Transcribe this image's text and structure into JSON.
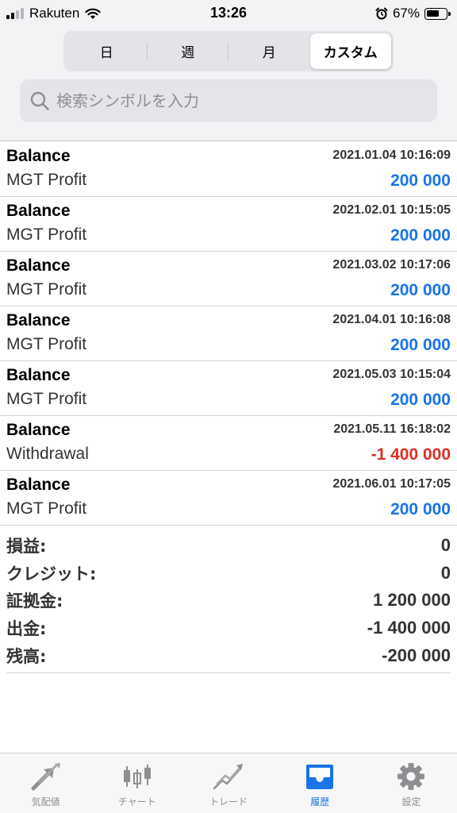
{
  "status_bar": {
    "carrier": "Rakuten",
    "time": "13:26",
    "battery_percent": "67%",
    "battery_level": 0.67
  },
  "period_tabs": [
    {
      "label": "日",
      "active": false
    },
    {
      "label": "週",
      "active": false
    },
    {
      "label": "月",
      "active": false
    },
    {
      "label": "カスタム",
      "active": true
    }
  ],
  "search": {
    "placeholder": "検索シンボルを入力",
    "value": ""
  },
  "history": [
    {
      "title": "Balance",
      "datetime": "2021.01.04 10:16:09",
      "comment": "MGT Profit",
      "amount": "200 000",
      "sign": "positive"
    },
    {
      "title": "Balance",
      "datetime": "2021.02.01 10:15:05",
      "comment": "MGT Profit",
      "amount": "200 000",
      "sign": "positive"
    },
    {
      "title": "Balance",
      "datetime": "2021.03.02 10:17:06",
      "comment": "MGT Profit",
      "amount": "200 000",
      "sign": "positive"
    },
    {
      "title": "Balance",
      "datetime": "2021.04.01 10:16:08",
      "comment": "MGT Profit",
      "amount": "200 000",
      "sign": "positive"
    },
    {
      "title": "Balance",
      "datetime": "2021.05.03 10:15:04",
      "comment": "MGT Profit",
      "amount": "200 000",
      "sign": "positive"
    },
    {
      "title": "Balance",
      "datetime": "2021.05.11 16:18:02",
      "comment": "Withdrawal",
      "amount": "-1 400 000",
      "sign": "negative"
    },
    {
      "title": "Balance",
      "datetime": "2021.06.01 10:17:05",
      "comment": "MGT Profit",
      "amount": "200 000",
      "sign": "positive"
    }
  ],
  "summary": [
    {
      "label": "損益:",
      "value": "0"
    },
    {
      "label": "クレジット:",
      "value": "0"
    },
    {
      "label": "証拠金:",
      "value": "1 200 000"
    },
    {
      "label": "出金:",
      "value": "-1 400 000"
    },
    {
      "label": "残高:",
      "value": "-200 000"
    }
  ],
  "tab_bar": [
    {
      "label": "気配値",
      "icon": "quotes-arrows-icon",
      "active": false
    },
    {
      "label": "チャート",
      "icon": "candlestick-chart-icon",
      "active": false
    },
    {
      "label": "トレード",
      "icon": "trade-trend-icon",
      "active": false
    },
    {
      "label": "履歴",
      "icon": "history-inbox-icon",
      "active": true
    },
    {
      "label": "設定",
      "icon": "settings-gear-icon",
      "active": false
    }
  ],
  "colors": {
    "positive": "#1a73e8",
    "negative": "#d93025",
    "tab_active": "#1a73e8",
    "tab_inactive": "#8e8e93"
  }
}
